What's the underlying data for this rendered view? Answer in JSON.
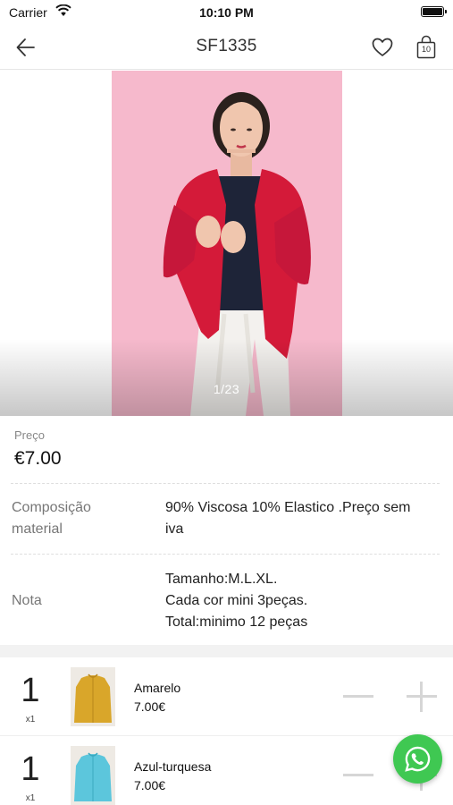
{
  "status_bar": {
    "carrier": "Carrier",
    "time": "10:10 PM",
    "battery_level": 1.0
  },
  "nav": {
    "title": "SF1335",
    "back_icon": "arrow-left-icon",
    "favorite_icon": "heart-icon",
    "cart_icon": "shopping-bag-icon",
    "cart_count": "10"
  },
  "gallery": {
    "counter": "1/23",
    "background_color": "#f6b9cc"
  },
  "price": {
    "label": "Preço",
    "value": "€7.00"
  },
  "specs": {
    "composition_key_line1": "Composição",
    "composition_key_line2": "material",
    "composition_value_line1": "90% Viscosa 10% Elastico .Preço sem",
    "composition_value_line2": "iva",
    "note_key": "Nota",
    "note_line1": "Tamanho:M.L.XL.",
    "note_line2": "Cada cor mini 3peças.",
    "note_line3": "Total:minimo 12 peças"
  },
  "variants": [
    {
      "qty": "1",
      "qty_unit": "x1",
      "name": "Amarelo",
      "price": "7.00€",
      "color": "#d9a62a"
    },
    {
      "qty": "1",
      "qty_unit": "x1",
      "name": "Azul-turquesa",
      "price": "7.00€",
      "color": "#5cc6dc"
    }
  ],
  "whatsapp": {
    "icon": "whatsapp-icon",
    "color": "#3fc852"
  }
}
